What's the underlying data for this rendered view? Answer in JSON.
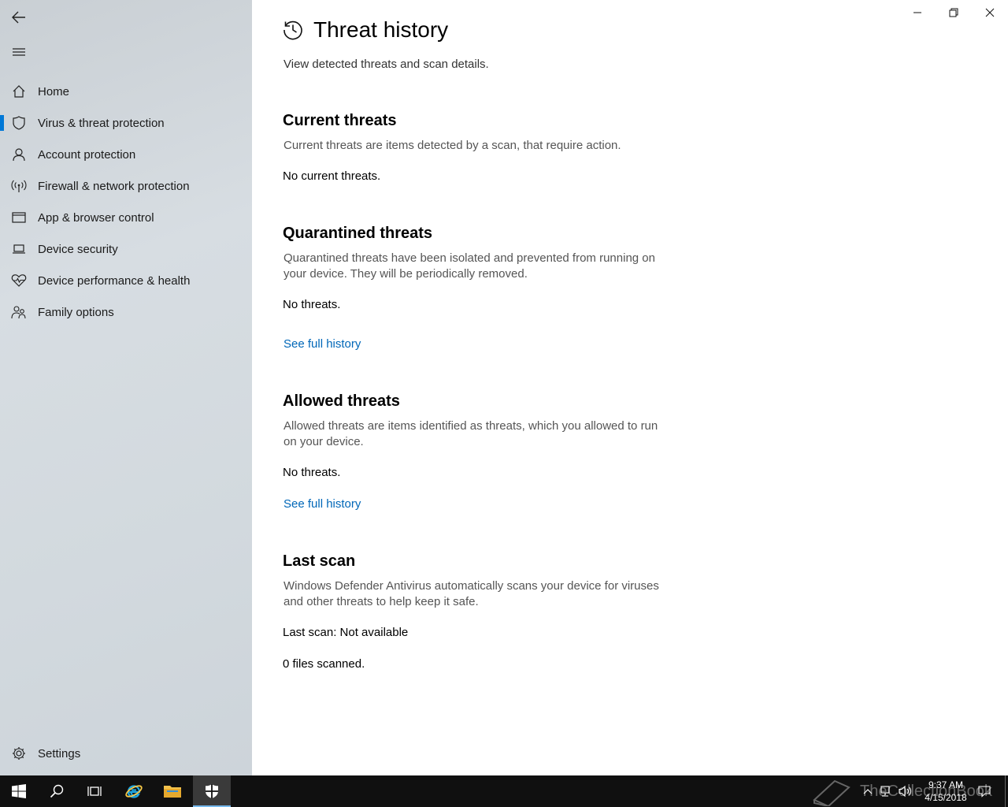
{
  "window": {
    "controls": {
      "minimize": "minimize",
      "restore": "restore",
      "close": "close"
    }
  },
  "sidebar": {
    "back_icon": "back-arrow-icon",
    "menu_icon": "hamburger-icon",
    "items": [
      {
        "label": "Home",
        "icon": "home-icon"
      },
      {
        "label": "Virus & threat protection",
        "icon": "shield-icon",
        "active": true
      },
      {
        "label": "Account protection",
        "icon": "person-icon"
      },
      {
        "label": "Firewall & network protection",
        "icon": "wifi-antenna-icon"
      },
      {
        "label": "App & browser control",
        "icon": "browser-window-icon"
      },
      {
        "label": "Device security",
        "icon": "laptop-icon"
      },
      {
        "label": "Device performance & health",
        "icon": "heart-pulse-icon"
      },
      {
        "label": "Family options",
        "icon": "family-icon"
      }
    ],
    "settings_label": "Settings"
  },
  "main": {
    "title": "Threat history",
    "subtitle": "View detected threats and scan details.",
    "current": {
      "heading": "Current threats",
      "desc": "Current threats are items detected by a scan, that require action.",
      "status": "No current threats."
    },
    "quarantined": {
      "heading": "Quarantined threats",
      "desc": "Quarantined threats have been isolated and prevented from running on your device.  They will be periodically removed.",
      "status": "No threats.",
      "link": "See full history"
    },
    "allowed": {
      "heading": "Allowed threats",
      "desc": "Allowed threats are items identified as threats, which you allowed to run on your device.",
      "status": "No threats.",
      "link": "See full history"
    },
    "last_scan": {
      "heading": "Last scan",
      "desc": "Windows Defender Antivirus automatically scans your device for viruses and other threats to help keep it safe.",
      "status": "Last scan:  Not available",
      "files": "0 files scanned."
    }
  },
  "taskbar": {
    "time": "9:37 AM",
    "date": "4/15/2018",
    "watermark": "TheCollectionBook",
    "accent": "#76b9ed"
  },
  "colors": {
    "accent": "#0078d7",
    "link": "#0067b8"
  }
}
